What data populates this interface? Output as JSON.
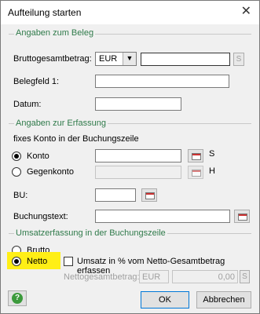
{
  "window": {
    "title": "Aufteilung starten",
    "close_glyph": "✕"
  },
  "groups": {
    "beleg": "Angaben zum Beleg",
    "erfassung": "Angaben zur Erfassung",
    "umsatz": "Umsatzerfassung in der Buchungszeile"
  },
  "beleg": {
    "brutto_label": "Bruttogesamtbetrag:",
    "currency": "EUR",
    "brutto_value": "",
    "brutto_suffix": "S",
    "belegfeld_label": "Belegfeld 1:",
    "belegfeld_value": "",
    "datum_label": "Datum:",
    "datum_value": ""
  },
  "erfassung": {
    "fixes_label": "fixes Konto in der Buchungszeile",
    "konto_label": "Konto",
    "konto_selected": true,
    "konto_value": "",
    "konto_suffix": "S",
    "gegenkonto_label": "Gegenkonto",
    "gegenkonto_suffix": "H",
    "bu_label": "BU:",
    "bu_value": "",
    "buchungstext_label": "Buchungstext:",
    "buchungstext_value": ""
  },
  "umsatz": {
    "brutto_label": "Brutto",
    "netto_label": "Netto",
    "netto_selected": true,
    "checkbox_label": "Umsatz in % vom Netto-Gesamtbetrag erfassen",
    "checkbox_checked": false,
    "nettogesamt_label": "Nettogesamtbetrag:",
    "nettogesamt_currency": "EUR",
    "nettogesamt_value": "0,00",
    "nettogesamt_suffix": "S",
    "highlight_color": "#ffef16"
  },
  "buttons": {
    "ok": "OK",
    "abbrechen": "Abbrechen",
    "help_glyph": "?"
  },
  "colors": {
    "legend": "#2f7a4a",
    "accent": "#0078d7"
  }
}
